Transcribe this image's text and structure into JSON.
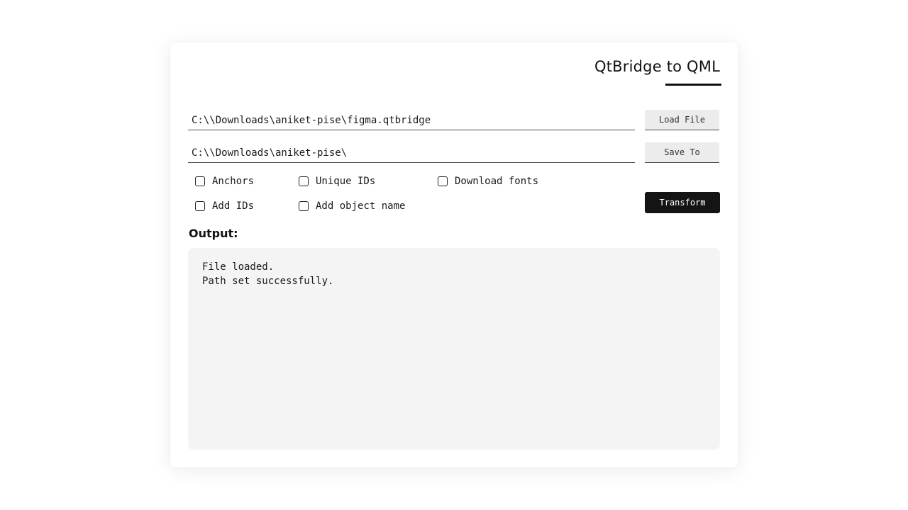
{
  "app": {
    "title": "QtBridge to QML"
  },
  "inputs": {
    "load_path": "C:\\\\Downloads\\aniket-pise\\figma.qtbridge",
    "save_path": "C:\\\\Downloads\\aniket-pise\\"
  },
  "buttons": {
    "load_label": "Load File",
    "save_label": "Save To",
    "transform_label": "Transform"
  },
  "options": [
    {
      "label": "Anchors",
      "checked": false
    },
    {
      "label": "Unique IDs",
      "checked": false
    },
    {
      "label": "Download fonts",
      "checked": false
    },
    {
      "label": "Add IDs",
      "checked": false
    },
    {
      "label": "Add object name",
      "checked": false
    }
  ],
  "output": {
    "label": "Output:",
    "lines": [
      "File loaded.",
      "Path set successfully."
    ]
  }
}
